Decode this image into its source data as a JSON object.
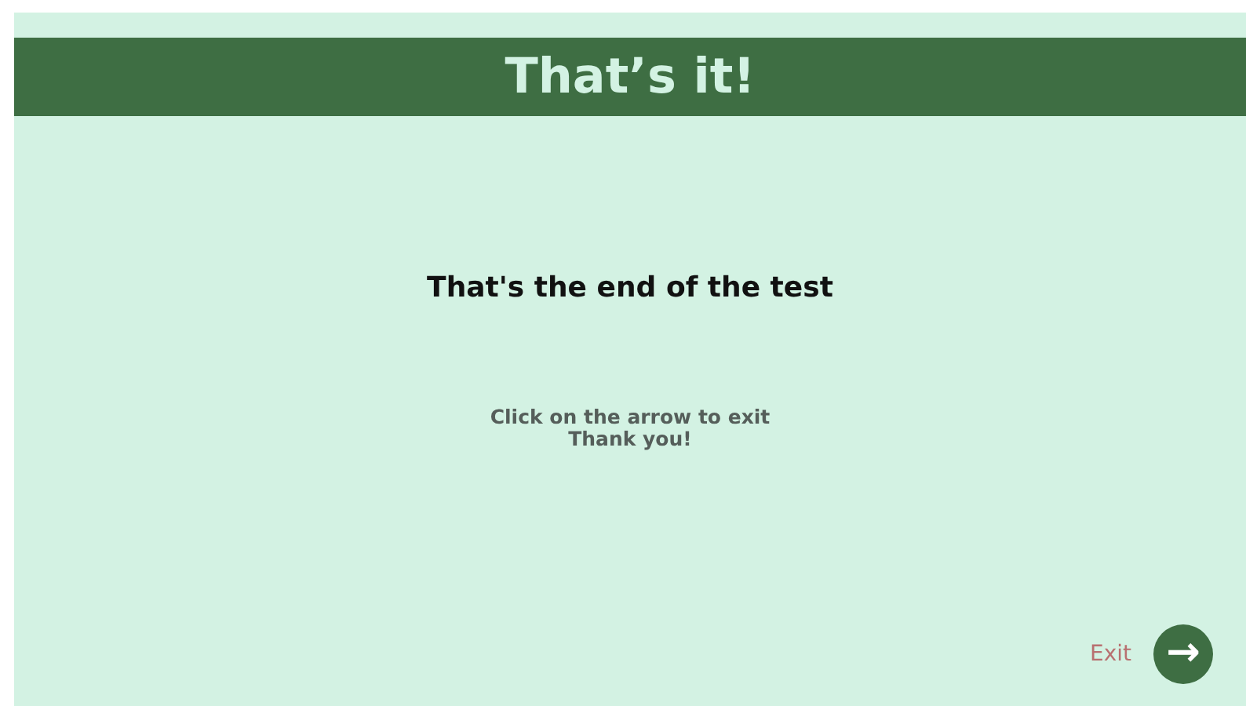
{
  "header": {
    "title": "That’s it!"
  },
  "heading": "That's the end of the test",
  "message_lines": [
    "Click on the arrow to exit",
    "Thank you!"
  ],
  "exit": {
    "label": "Exit",
    "arrow": "→"
  }
}
